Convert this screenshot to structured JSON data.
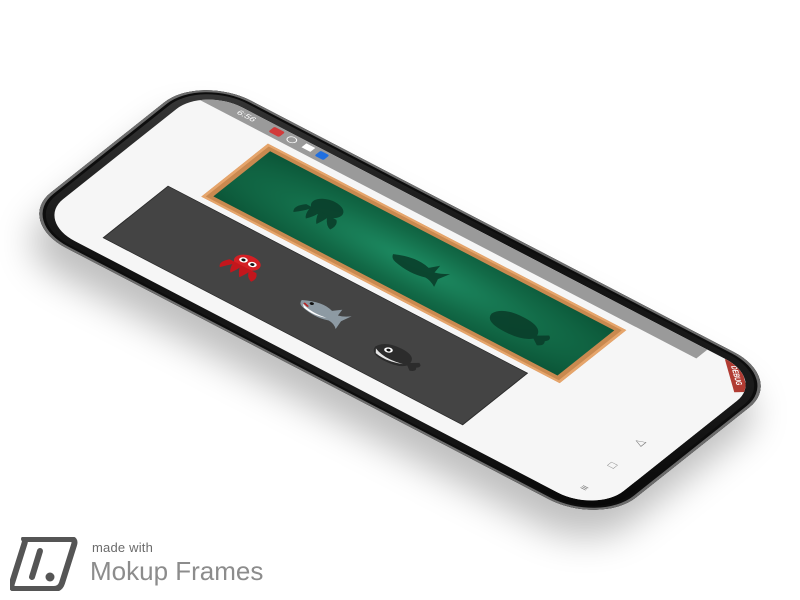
{
  "status_bar": {
    "time": "6:56"
  },
  "game": {
    "targets": [
      "octopus",
      "shark",
      "whale"
    ],
    "pieces": [
      "octopus",
      "shark",
      "whale"
    ]
  },
  "nav": {
    "back_icon": "triangle-back-icon",
    "home_icon": "square-home-icon",
    "menu_icon": "lines-menu-icon"
  },
  "banner": "DEBUG",
  "watermark": {
    "small": "made with",
    "big": "Mokup Frames"
  },
  "colors": {
    "board_green": "#137a52",
    "board_frame": "#c9894f",
    "tray": "#444444",
    "octopus": "#d41f24",
    "debug": "#b13c33"
  }
}
